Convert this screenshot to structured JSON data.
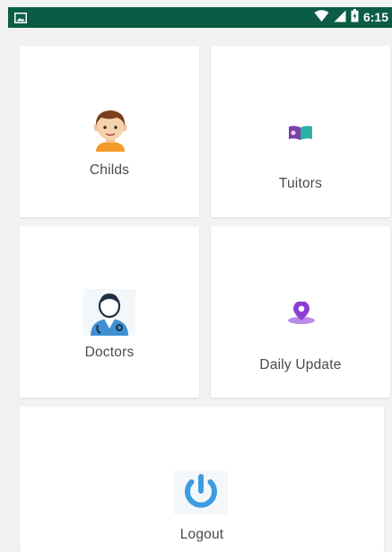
{
  "status_bar": {
    "time": "6:15",
    "background": "#0a5c45",
    "icons": [
      "image-notification-icon",
      "wifi-icon",
      "signal-icon",
      "battery-icon"
    ]
  },
  "menu": {
    "childs": {
      "label": "Childs",
      "icon": "child-icon"
    },
    "tuitors": {
      "label": "Tuitors",
      "icon": "book-icon"
    },
    "doctors": {
      "label": "Doctors",
      "icon": "doctor-icon"
    },
    "daily_update": {
      "label": "Daily Update",
      "icon": "location-pin-icon"
    },
    "logout": {
      "label": "Logout",
      "icon": "power-icon"
    }
  },
  "colors": {
    "background": "#f2f2f2",
    "card": "#ffffff",
    "label": "#4a4a4a",
    "power_icon": "#3d9be0",
    "pin_icon": "#8b3fd1"
  }
}
